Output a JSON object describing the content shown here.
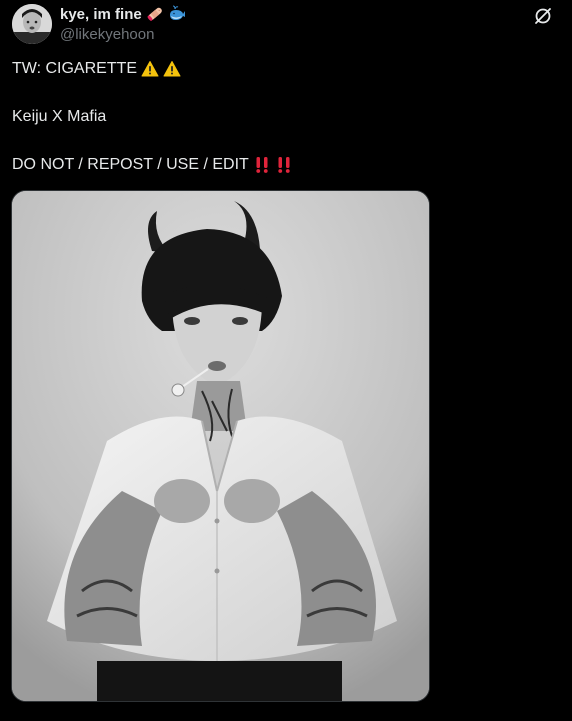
{
  "author": {
    "display_name": "kye, im fine",
    "handle": "@likekyehoon",
    "name_emojis": [
      "bandage-icon",
      "whale-icon"
    ]
  },
  "header": {
    "action_icon": "grok-icon"
  },
  "tweet": {
    "line1": "TW: CIGARETTE",
    "line1_emojis": [
      "warning-icon",
      "warning-icon"
    ],
    "line2": "Keiju X Mafia",
    "line3": "DO NOT / REPOST / USE / EDIT",
    "line3_emojis": [
      "double-exclamation-icon",
      "double-exclamation-icon"
    ]
  },
  "colors": {
    "background": "#000000",
    "text": "#e7e9ea",
    "secondary_text": "#71767b",
    "warning": "#f4c20d",
    "exclamation": "#e0243b"
  }
}
